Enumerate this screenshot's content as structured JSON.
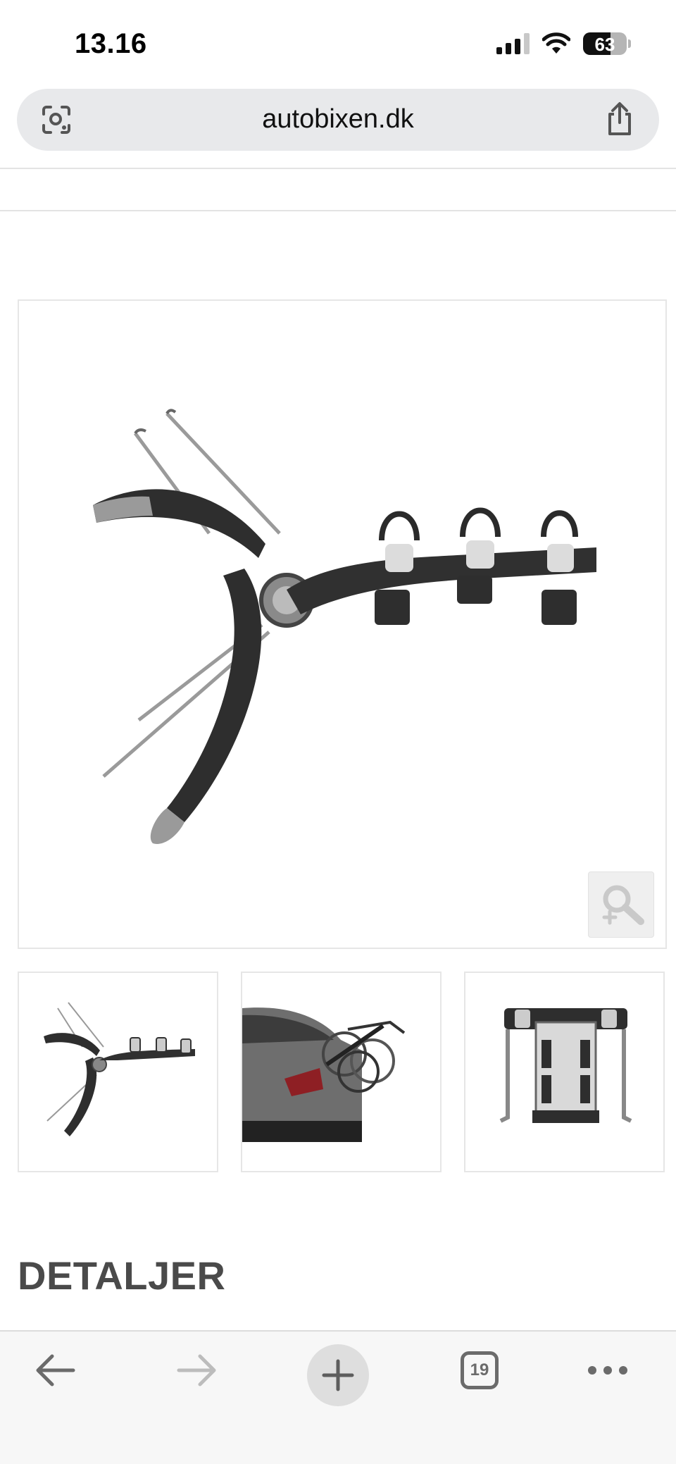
{
  "status_bar": {
    "time": "13.16",
    "battery": "63"
  },
  "browser": {
    "url": "autobixen.dk",
    "tab_count": "19"
  },
  "product": {
    "images": [
      {
        "name": "Thule bike rack side view"
      },
      {
        "name": "Bike rack mounted on car with bikes"
      },
      {
        "name": "Bike rack front view"
      }
    ]
  },
  "section": {
    "heading": "DETALJER"
  },
  "icons": {
    "lens": "visual-search-icon",
    "share": "share-icon",
    "zoom": "magnifier-plus-icon",
    "back": "arrow-left-icon",
    "forward": "arrow-right-icon",
    "new_tab": "plus-icon",
    "more": "ellipsis-icon"
  }
}
